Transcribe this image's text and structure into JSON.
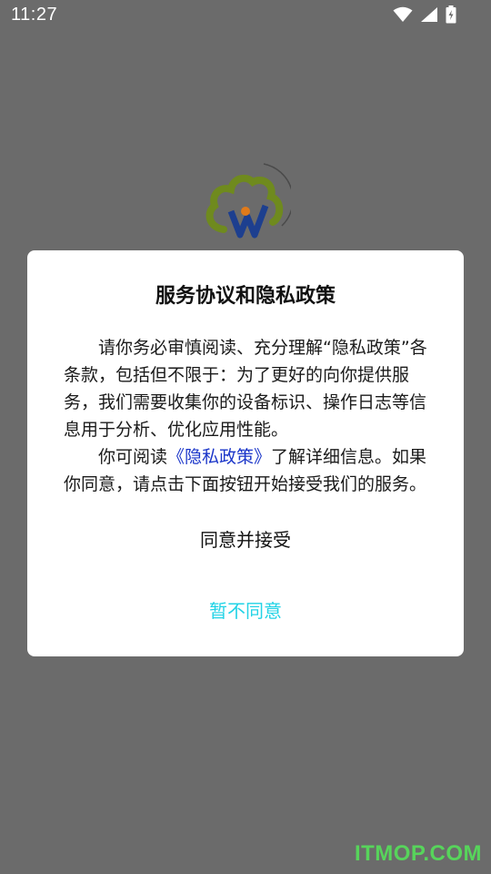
{
  "status_bar": {
    "time": "11:27",
    "icons": [
      "wifi-icon",
      "signal-icon",
      "battery-icon"
    ]
  },
  "logo": {
    "icon": "cloud-w-logo-icon"
  },
  "dialog": {
    "title": "服务协议和隐私政策",
    "paragraph1": "请你务必审慎阅读、充分理解“隐私政策”各条款，包括但不限于：为了更好的向你提供服务，我们需要收集你的设备标识、操作日志等信息用于分析、优化应用性能。",
    "paragraph2_prefix": "你可阅读",
    "privacy_link": "《隐私政策》",
    "paragraph2_suffix": "了解详细信息。如果你同意，请点击下面按钮开始接受我们的服务。",
    "agree_label": "同意并接受",
    "decline_label": "暂不同意"
  },
  "watermark": "ITMOP.COM",
  "colors": {
    "overlay": "#6b6b6b",
    "link": "#1a35c9",
    "decline": "#22d3e6",
    "watermark": "#55e05a"
  }
}
